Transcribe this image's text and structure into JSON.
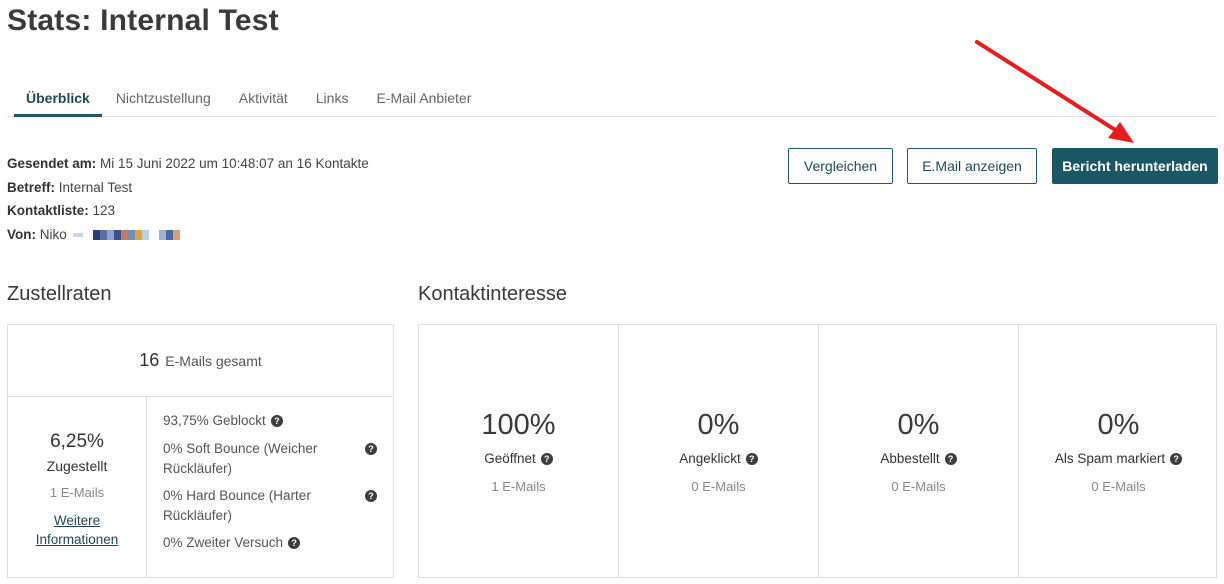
{
  "page": {
    "title": "Stats: Internal Test"
  },
  "tabs": [
    {
      "label": "Überblick",
      "active": true
    },
    {
      "label": "Nichtzustellung"
    },
    {
      "label": "Aktivität"
    },
    {
      "label": "Links"
    },
    {
      "label": "E-Mail Anbieter"
    }
  ],
  "meta": {
    "sent_label": "Gesendet am:",
    "sent_value": "Mi 15 Juni 2022 um 10:48:07 an 16 Kontakte",
    "subject_label": "Betreff:",
    "subject_value": "Internal Test",
    "list_label": "Kontaktliste:",
    "list_value": "123",
    "from_label": "Von:",
    "from_value": "Niko"
  },
  "buttons": {
    "compare": "Vergleichen",
    "show_email": "E.Mail anzeigen",
    "download": "Bericht herunterladen"
  },
  "delivery": {
    "title": "Zustellraten",
    "total_count": "16",
    "total_label": "E-Mails gesamt",
    "delivered_pct": "6,25%",
    "delivered_label": "Zugestellt",
    "delivered_count": "1 E-Mails",
    "more_info_line1": "Weitere",
    "more_info_line2": "Informationen",
    "blocked": "93,75%  Geblockt",
    "soft_bounce_line1": "0%  Soft Bounce (Weicher",
    "soft_bounce_line2": "Rückläufer)",
    "hard_bounce_line1": "0%  Hard Bounce (Harter",
    "hard_bounce_line2": "Rückläufer)",
    "retry": "0%  Zweiter Versuch"
  },
  "interest": {
    "title": "Kontaktinteresse",
    "cells": [
      {
        "pct": "100%",
        "label": "Geöffnet",
        "count": "1 E-Mails"
      },
      {
        "pct": "0%",
        "label": "Angeklickt",
        "count": "0 E-Mails"
      },
      {
        "pct": "0%",
        "label": "Abbestellt",
        "count": "0 E-Mails"
      },
      {
        "pct": "0%",
        "label": "Als Spam markiert",
        "count": "0 E-Mails"
      }
    ]
  },
  "icons": {
    "help": "?",
    "help_icon": "question-circle-icon",
    "arrow_annotation": "red-arrow-icon"
  },
  "colors": {
    "accent": "#1b5664",
    "annotation": "#e81c1c"
  }
}
